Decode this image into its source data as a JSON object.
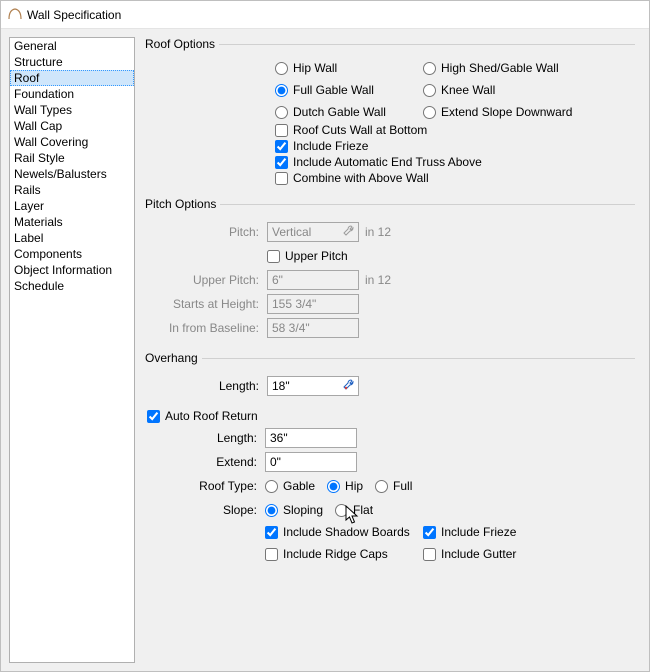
{
  "title": "Wall Specification",
  "sidebar": {
    "items": [
      {
        "label": "General"
      },
      {
        "label": "Structure"
      },
      {
        "label": "Roof",
        "selected": true
      },
      {
        "label": "Foundation"
      },
      {
        "label": "Wall Types"
      },
      {
        "label": "Wall Cap"
      },
      {
        "label": "Wall Covering"
      },
      {
        "label": "Rail Style"
      },
      {
        "label": "Newels/Balusters"
      },
      {
        "label": "Rails"
      },
      {
        "label": "Layer"
      },
      {
        "label": "Materials"
      },
      {
        "label": "Label"
      },
      {
        "label": "Components"
      },
      {
        "label": "Object Information"
      },
      {
        "label": "Schedule"
      }
    ]
  },
  "roof_options": {
    "legend": "Roof Options",
    "radios": {
      "hip_wall": "Hip Wall",
      "high_shed_gable": "High Shed/Gable Wall",
      "full_gable": "Full Gable Wall",
      "knee_wall": "Knee Wall",
      "dutch_gable": "Dutch Gable Wall",
      "extend_slope": "Extend Slope Downward",
      "selected": "full_gable"
    },
    "checks": {
      "roof_cuts": {
        "label": "Roof Cuts Wall at Bottom",
        "checked": false
      },
      "include_frieze": {
        "label": "Include Frieze",
        "checked": true
      },
      "include_truss": {
        "label": "Include Automatic End Truss Above",
        "checked": true
      },
      "combine_above": {
        "label": "Combine with Above Wall",
        "checked": false
      }
    }
  },
  "pitch_options": {
    "legend": "Pitch Options",
    "pitch_label": "Pitch:",
    "pitch_value": "Vertical",
    "pitch_unit": "in 12",
    "upper_pitch_check": {
      "label": "Upper Pitch",
      "checked": false
    },
    "upper_pitch_label": "Upper Pitch:",
    "upper_pitch_value": "6\"",
    "upper_pitch_unit": "in 12",
    "starts_label": "Starts at Height:",
    "starts_value": "155 3/4\"",
    "in_from_label": "In from Baseline:",
    "in_from_value": "58 3/4\""
  },
  "overhang": {
    "legend": "Overhang",
    "length_label": "Length:",
    "length_value": "18\""
  },
  "auto_roof_return": {
    "check": {
      "label": "Auto Roof Return",
      "checked": true
    },
    "length_label": "Length:",
    "length_value": "36\"",
    "extend_label": "Extend:",
    "extend_value": "0\"",
    "roof_type_label": "Roof Type:",
    "roof_type": {
      "gable": "Gable",
      "hip": "Hip",
      "full": "Full",
      "selected": "hip"
    },
    "slope_label": "Slope:",
    "slope": {
      "sloping": "Sloping",
      "flat": "Flat",
      "selected": "sloping"
    },
    "checks": {
      "shadow_boards": {
        "label": "Include Shadow Boards",
        "checked": true
      },
      "frieze": {
        "label": "Include Frieze",
        "checked": true
      },
      "ridge_caps": {
        "label": "Include Ridge Caps",
        "checked": false
      },
      "gutter": {
        "label": "Include Gutter",
        "checked": false
      }
    }
  }
}
